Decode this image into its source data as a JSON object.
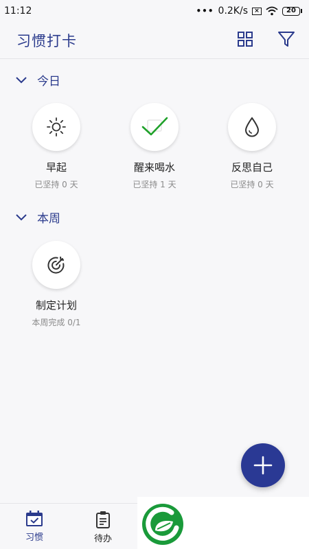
{
  "status_bar": {
    "time": "11:12",
    "dots": "•••",
    "speed": "0.2K/s",
    "battery": "20"
  },
  "app_bar": {
    "title": "习惯打卡",
    "actions": [
      "grid-view-icon",
      "filter-icon"
    ]
  },
  "sections": [
    {
      "label": "今日",
      "habits": [
        {
          "name": "早起",
          "status": "已坚持 0 天",
          "icon": "sun-icon"
        },
        {
          "name": "醒来喝水",
          "status": "已坚持 1 天",
          "icon": "checkmark-icon"
        },
        {
          "name": "反思自己",
          "status": "已坚持 0 天",
          "icon": "water-drop-icon"
        }
      ]
    },
    {
      "label": "本周",
      "habits": [
        {
          "name": "制定计划",
          "status": "本周完成 0/1",
          "icon": "target-icon"
        }
      ]
    }
  ],
  "fab": {
    "icon": "plus-icon"
  },
  "bottom_nav": {
    "items": [
      {
        "label": "习惯",
        "icon": "calendar-check-icon",
        "active": true
      },
      {
        "label": "待办",
        "icon": "clipboard-icon",
        "active": false
      }
    ]
  },
  "colors": {
    "accent": "#2a3a8c",
    "fab": "#2a3994",
    "check_green": "#1fa12a",
    "logo_green": "#1a9a3a"
  }
}
